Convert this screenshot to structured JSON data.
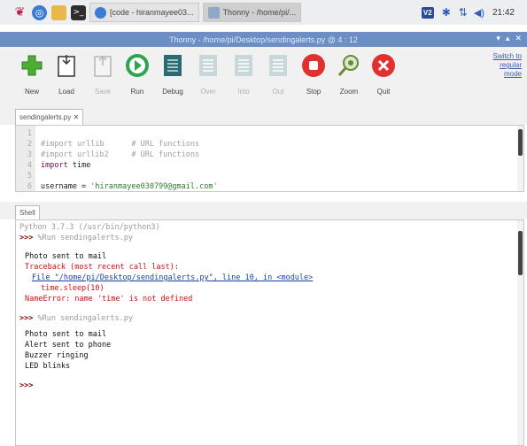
{
  "taskbar": {
    "tasks": [
      {
        "label": "[code - hiranmayee03..."
      },
      {
        "label": "Thonny - /home/pi/..."
      }
    ],
    "clock": "21:42",
    "vnc_label": "V2"
  },
  "window": {
    "title": "Thonny  -  /home/pi/Desktop/sendingalerts.py  @  4 : 12",
    "switch_mode": "Switch to\nregular\nmode"
  },
  "toolbar": {
    "buttons": [
      {
        "label": "New"
      },
      {
        "label": "Load"
      },
      {
        "label": "Save"
      },
      {
        "label": "Run"
      },
      {
        "label": "Debug"
      },
      {
        "label": "Over"
      },
      {
        "label": "Into"
      },
      {
        "label": "Out"
      },
      {
        "label": "Stop"
      },
      {
        "label": "Zoom"
      },
      {
        "label": "Quit"
      }
    ]
  },
  "editor": {
    "tab_label": "sendingalerts.py ✕",
    "lines": [
      {
        "num": "1",
        "text": ""
      },
      {
        "num": "2",
        "text": "#import urllib      # URL functions"
      },
      {
        "num": "3",
        "text": "#import urllib2     # URL functions"
      },
      {
        "num": "4",
        "kw": "import",
        "text": " time"
      },
      {
        "num": "5",
        "text": ""
      },
      {
        "num": "6",
        "text": "username = ",
        "str": "'hiranmayee030799@gmail.com'"
      }
    ]
  },
  "shell": {
    "tab_label": "Shell",
    "header": "Python 3.7.3 (/usr/bin/python3)",
    "prompt": ">>>",
    "run1": "%Run sendingalerts.py",
    "out1": "Photo sent to mail",
    "tb_head": "Traceback (most recent call last):",
    "tb_file": "File \"/home/pi/Desktop/sendingalerts.py\", line 10, in <module>",
    "tb_code": "time.sleep(10)",
    "tb_err": "NameError: name 'time' is not defined",
    "run2": "%Run sendingalerts.py",
    "out2": [
      "Photo sent to mail",
      "Alert sent to phone",
      "Buzzer ringing",
      "LED blinks"
    ]
  }
}
